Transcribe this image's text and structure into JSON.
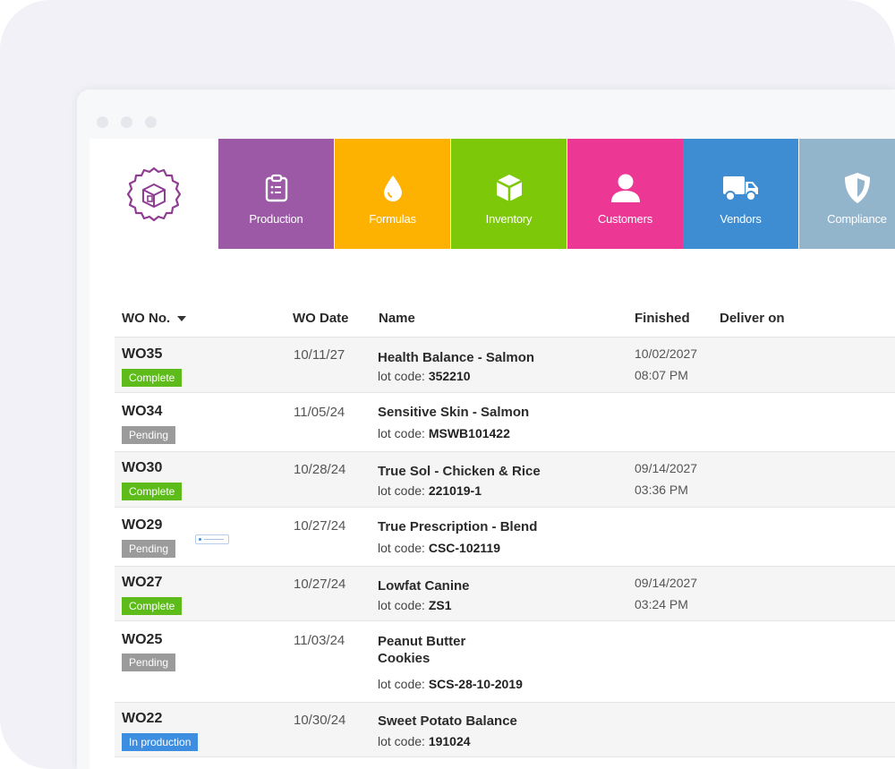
{
  "nav": [
    {
      "label": "Production",
      "icon": "clipboard-icon",
      "color": "#9b59a6"
    },
    {
      "label": "Formulas",
      "icon": "drop-icon",
      "color": "#fdb201"
    },
    {
      "label": "Inventory",
      "icon": "box-icon",
      "color": "#7dc808"
    },
    {
      "label": "Customers",
      "icon": "person-icon",
      "color": "#ec3795"
    },
    {
      "label": "Vendors",
      "icon": "truck-icon",
      "color": "#3e8dd2"
    },
    {
      "label": "Compliance",
      "icon": "shield-icon",
      "color": "#93b5cb"
    }
  ],
  "table": {
    "headers": {
      "wo": "WO No.",
      "date": "WO Date",
      "name": "Name",
      "finished": "Finished",
      "deliver": "Deliver on"
    },
    "lot_label": "lot code:",
    "rows": [
      {
        "wo": "WO35",
        "status": "Complete",
        "date": "10/11/27",
        "name": "Health Balance - Salmon",
        "lot": "352210",
        "finished_date": "10/02/2027",
        "finished_time": "08:07 PM"
      },
      {
        "wo": "WO34",
        "status": "Pending",
        "date": "11/05/24",
        "name": "Sensitive Skin - Salmon",
        "lot": "MSWB101422",
        "finished_date": "",
        "finished_time": ""
      },
      {
        "wo": "WO30",
        "status": "Complete",
        "date": "10/28/24",
        "name": "True Sol - Chicken & Rice",
        "lot": "221019-1",
        "finished_date": "09/14/2027",
        "finished_time": "03:36 PM"
      },
      {
        "wo": "WO29",
        "status": "Pending",
        "date": "10/27/24",
        "name": "True Prescription - Blend",
        "lot": "CSC-102119",
        "finished_date": "",
        "finished_time": ""
      },
      {
        "wo": "WO27",
        "status": "Complete",
        "date": "10/27/24",
        "name": "Lowfat Canine",
        "lot": "ZS1",
        "finished_date": "09/14/2027",
        "finished_time": "03:24 PM"
      },
      {
        "wo": "WO25",
        "status": "Pending",
        "date": "11/03/24",
        "name_line1": "Peanut Butter",
        "name_line2": "Cookies",
        "lot": "SCS-28-10-2019",
        "finished_date": "",
        "finished_time": ""
      },
      {
        "wo": "WO22",
        "status": "In production",
        "date": "10/30/24",
        "name": "Sweet Potato Balance",
        "lot": "191024",
        "finished_date": "",
        "finished_time": ""
      }
    ]
  }
}
